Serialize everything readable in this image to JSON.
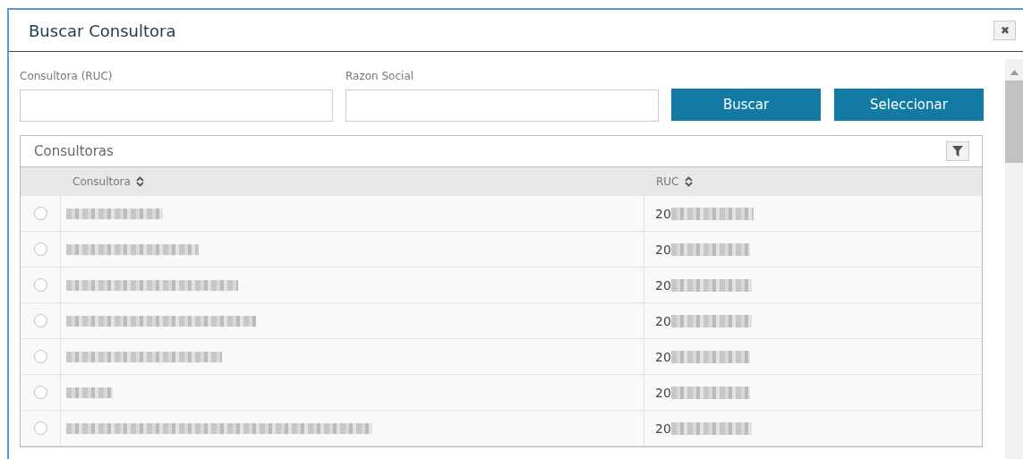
{
  "dialog": {
    "title": "Buscar Consultora",
    "close_label": "✖"
  },
  "form": {
    "fields": [
      {
        "label": "Consultora (RUC)"
      },
      {
        "label": "Razon Social"
      }
    ],
    "buttons": [
      "Buscar",
      "Seleccionar"
    ]
  },
  "table": {
    "title": "Consultoras",
    "columns": [
      "Consultora",
      "RUC"
    ],
    "rows": [
      {
        "selected": false,
        "ruc": "20"
      },
      {
        "selected": false,
        "ruc": "20"
      },
      {
        "selected": false,
        "ruc": "20"
      },
      {
        "selected": false,
        "ruc": "20"
      },
      {
        "selected": false,
        "ruc": "20"
      },
      {
        "selected": false,
        "ruc": "20"
      },
      {
        "selected": false,
        "ruc": "20"
      }
    ]
  }
}
